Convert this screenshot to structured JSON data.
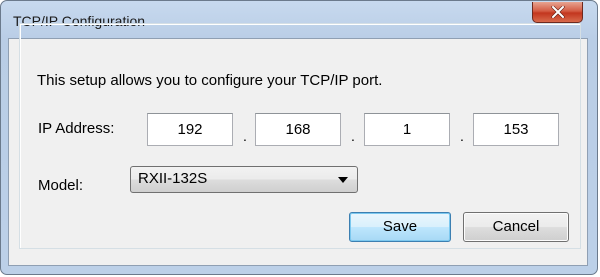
{
  "window": {
    "title": "TCP/IP Configuration"
  },
  "description": "This setup allows you to configure your TCP/IP port.",
  "ip_address": {
    "label": "IP Address:",
    "octets": [
      "192",
      "168",
      "1",
      "153"
    ],
    "separator": "."
  },
  "model": {
    "label": "Model:",
    "selected": "RXII-132S"
  },
  "buttons": {
    "save": "Save",
    "cancel": "Cancel"
  },
  "colors": {
    "frame": "#bcd0e8",
    "close_button": "#c3361e",
    "default_button_border": "#3c7fb1"
  },
  "icons": {
    "close": "close-icon",
    "dropdown": "chevron-down-icon"
  }
}
